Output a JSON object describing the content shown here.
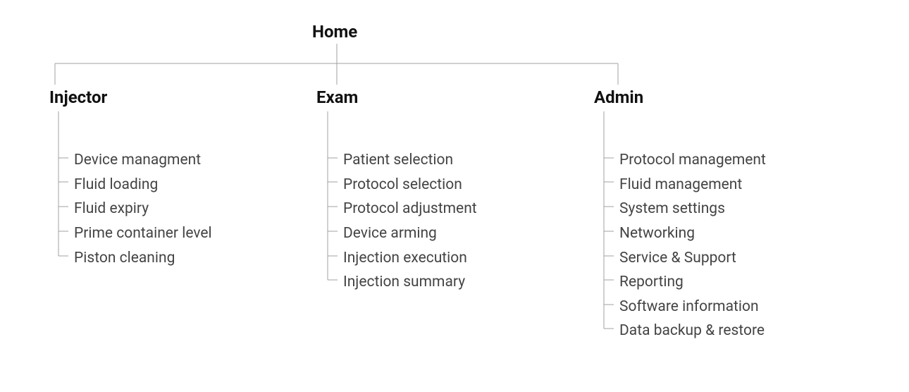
{
  "root": {
    "label": "Home"
  },
  "branches": [
    {
      "label": "Injector",
      "items": [
        "Device managment",
        "Fluid loading",
        "Fluid expiry",
        "Prime container level",
        "Piston cleaning"
      ]
    },
    {
      "label": "Exam",
      "items": [
        "Patient selection",
        "Protocol selection",
        "Protocol adjustment",
        "Device arming",
        "Injection execution",
        "Injection summary"
      ]
    },
    {
      "label": "Admin",
      "items": [
        "Protocol management",
        "Fluid management",
        "System settings",
        "Networking",
        "Service & Support",
        "Reporting",
        "Software information",
        "Data backup & restore"
      ]
    }
  ]
}
